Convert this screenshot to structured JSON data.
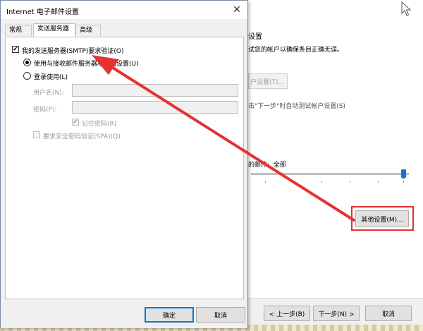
{
  "colors": {
    "annotation": "#e53232",
    "accent": "#0078d7"
  },
  "background_window": {
    "section_title": "设置",
    "section_desc": "试您的帐户以确保条目正确无误。",
    "test_button_label": "户设置(T)...",
    "auto_test_text": "击\"下一步\"时自动测试帐户设置(S)",
    "offline_label": "的邮件:",
    "offline_value": "全部",
    "more_settings_label": "其他设置(M)...",
    "prev_label": "< 上一步(B)",
    "next_label": "下一步(N) >",
    "cancel_label": "取消"
  },
  "dialog": {
    "title": "Internet 电子邮件设置",
    "close_icon": "close-icon",
    "tabs": [
      {
        "label": "常规",
        "active": false
      },
      {
        "label": "发送服务器",
        "active": true
      },
      {
        "label": "高级",
        "active": false
      }
    ],
    "smtp_auth_label": "我的发送服务器(SMTP)要求验证(O)",
    "smtp_auth_checked": true,
    "use_same_label": "使用与接收邮件服务器相同的设置(U)",
    "use_same_selected": true,
    "login_with_label": "登录使用(L)",
    "login_with_selected": false,
    "username_label": "用户名(N):",
    "username_value": "",
    "password_label": "密码(P):",
    "password_value": "",
    "remember_label": "记住密码(R)",
    "remember_checked": true,
    "spa_label": "要求安全密码验证(SPA)(Q)",
    "spa_checked": false,
    "ok_label": "确定",
    "cancel_label": "取消"
  }
}
